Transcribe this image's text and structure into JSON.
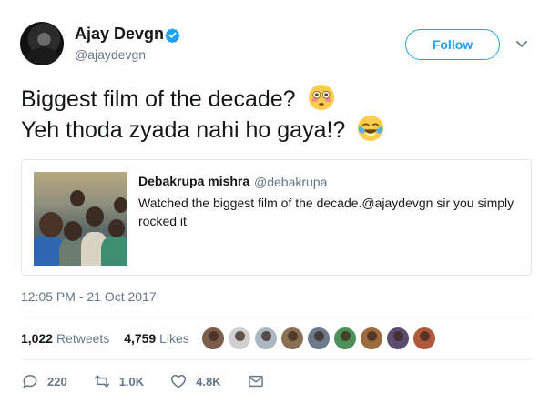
{
  "author": {
    "display_name": "Ajay Devgn",
    "handle": "@ajaydevgn",
    "verified": true
  },
  "follow_label": "Follow",
  "tweet": {
    "line1": "Biggest film of the decade?",
    "line2": "Yeh thoda zyada nahi ho gaya!?"
  },
  "quote": {
    "name": "Debakrupa mishra",
    "handle": "@debakrupa",
    "text": "Watched the biggest film of the decade.@ajaydevgn sir you simply rocked it"
  },
  "timestamp": "12:05 PM - 21 Oct 2017",
  "stats": {
    "retweets_count": "1,022",
    "retweets_label": "Retweets",
    "likes_count": "4,759",
    "likes_label": "Likes"
  },
  "liker_avatars": [
    "#7a5e4a",
    "#cfcfcf",
    "#aab8c2",
    "#8a6f55",
    "#6b7b8c",
    "#4f8f5a",
    "#9b6a3e",
    "#5c4c6e",
    "#b0583c"
  ],
  "actions": {
    "reply_count": "220",
    "retweet_count": "1.0K",
    "like_count": "4.8K"
  },
  "colors": {
    "accent": "#1da1f2",
    "muted": "#657786",
    "text": "#14171a",
    "border": "#e1e8ed"
  }
}
